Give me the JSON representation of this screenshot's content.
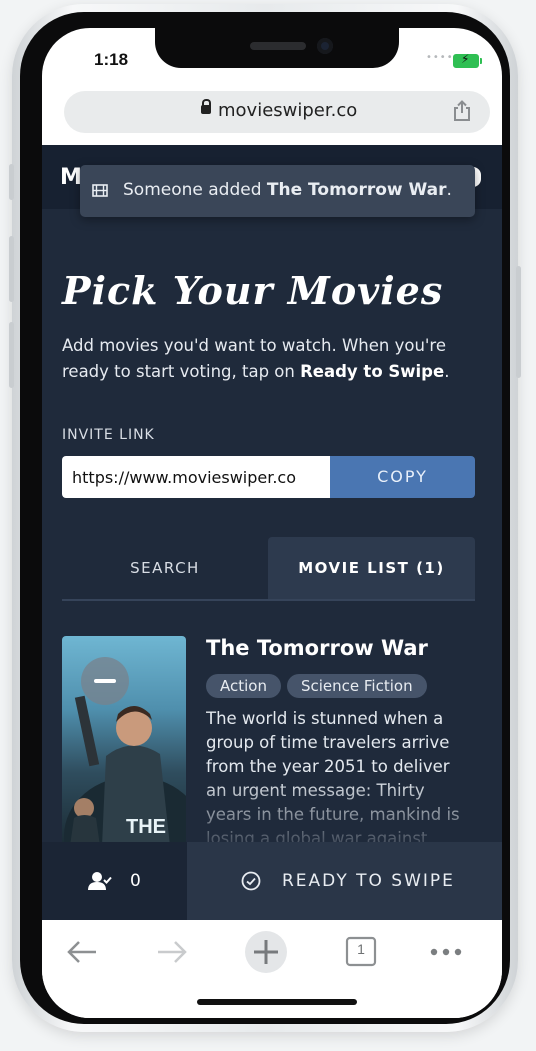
{
  "status_bar": {
    "time": "1:18"
  },
  "browser": {
    "url": "movieswiper.co",
    "tab_count": "1"
  },
  "header": {
    "partial_title": "M"
  },
  "toast": {
    "prefix": "Someone added ",
    "movie": "The Tomorrow War",
    "suffix": "."
  },
  "page": {
    "title": "Pick Your Movies",
    "intro_text": "Add movies you'd want to watch. When you're ready to start voting, tap on ",
    "intro_bold": "Ready to Swipe",
    "intro_end": "."
  },
  "invite": {
    "label": "INVITE LINK",
    "value": "https://www.movieswiper.co",
    "copy_label": "COPY"
  },
  "tabs": [
    {
      "label": "SEARCH",
      "active": false
    },
    {
      "label": "MOVIE LIST (1)",
      "active": true
    }
  ],
  "movie": {
    "title": "The Tomorrow War",
    "genres": [
      "Action",
      "Science Fiction"
    ],
    "synopsis": "The world is stunned when a group of time travelers arrive from the year 2051 to deliver an urgent message: Thirty years in the future, mankind is losing a global war against",
    "poster_text": "THE"
  },
  "bottom_bar": {
    "user_count": "0",
    "ready_label": "READY TO SWIPE"
  },
  "colors": {
    "app_background": "#1f2a3b",
    "accent_blue": "#4a76b2",
    "battery_green": "#2fbf53"
  },
  "icons": [
    "lock-icon",
    "share-icon",
    "film-icon",
    "minus-icon",
    "users-check-icon",
    "check-circle-icon",
    "back-arrow-icon",
    "forward-arrow-icon",
    "plus-icon",
    "tabs-icon",
    "more-icon"
  ]
}
